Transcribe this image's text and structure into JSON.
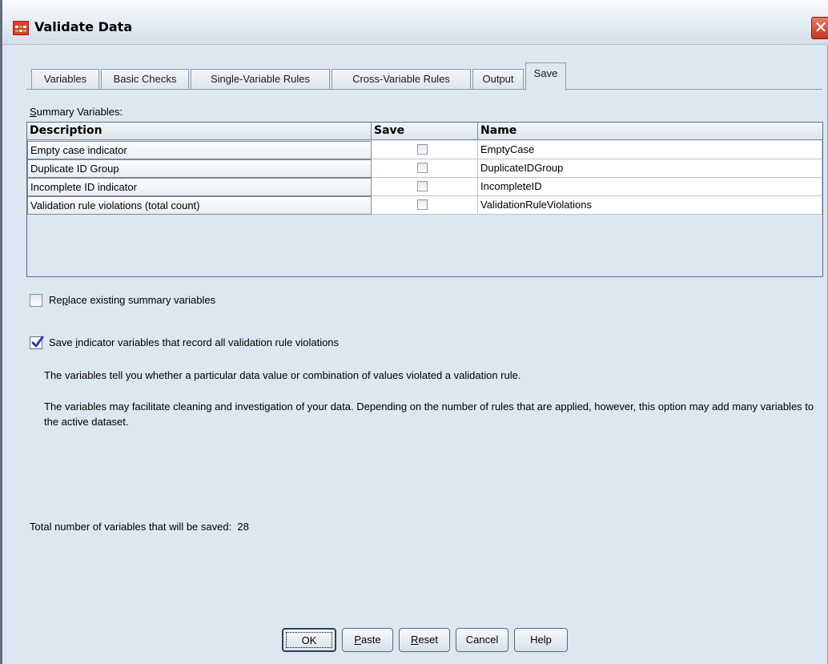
{
  "window": {
    "title": "Validate Data",
    "close_glyph": "✕"
  },
  "tabs": [
    {
      "label": "Variables"
    },
    {
      "label": "Basic Checks"
    },
    {
      "label": "Single-Variable Rules"
    },
    {
      "label": "Cross-Variable Rules"
    },
    {
      "label": "Output"
    },
    {
      "label": "Save",
      "active": true
    }
  ],
  "summary": {
    "label_prefix": "S",
    "label_rest": "ummary Variables:",
    "columns": {
      "description": "Description",
      "save": "Save",
      "name": "Name"
    },
    "rows": [
      {
        "description": "Empty case indicator",
        "save": false,
        "name": "EmptyCase"
      },
      {
        "description": "Duplicate ID Group",
        "save": false,
        "name": "DuplicateIDGroup"
      },
      {
        "description": "Incomplete ID indicator",
        "save": false,
        "name": "IncompleteID"
      },
      {
        "description": "Validation rule violations (total count)",
        "save": false,
        "name": "ValidationRuleViolations"
      }
    ]
  },
  "options": {
    "replace": {
      "prefix": "Re",
      "underlined": "p",
      "rest": "lace existing summary variables",
      "checked": false
    },
    "save_indicators": {
      "prefix": "Save ",
      "underlined": "i",
      "rest": "ndicator variables that record all validation rule violations",
      "checked": true
    }
  },
  "descriptions": {
    "p1": "The variables tell you whether a particular data value or combination of values violated a validation rule.",
    "p2": "The variables may facilitate cleaning and investigation of your data. Depending on the number of rules that are applied, however, this option may add many variables to the active dataset."
  },
  "total": {
    "label": "Total number of variables that will be saved:",
    "value": "28"
  },
  "buttons": {
    "ok": "OK",
    "paste_u": "P",
    "paste_rest": "aste",
    "reset_u": "R",
    "reset_rest": "eset",
    "cancel": "Cancel",
    "help": "Help"
  },
  "colors": {
    "background": "#dce7f2",
    "accent_check": "#2c3e9e",
    "icon_red": "#e33b2e"
  },
  "icons": {
    "app": "data-grid-icon",
    "close": "close-icon",
    "check": "checkmark-icon"
  }
}
